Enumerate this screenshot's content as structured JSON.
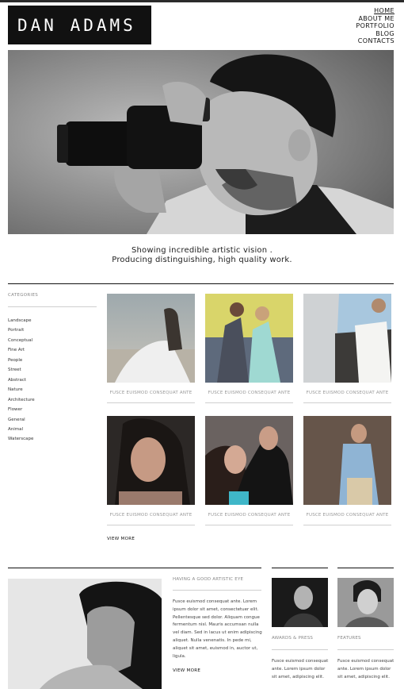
{
  "site": {
    "logo": "DAN ADAMS"
  },
  "nav": [
    {
      "label": "HOME",
      "active": true
    },
    {
      "label": "ABOUT ME"
    },
    {
      "label": "PORTFOLIO"
    },
    {
      "label": "BLOG"
    },
    {
      "label": "CONTACTS"
    }
  ],
  "hero": {
    "image": "photographer-with-camera-photo"
  },
  "tagline": {
    "line1": "Showing incredible artistic vision .",
    "line2": "Producing distinguishing, high quality work."
  },
  "sidebar": {
    "title": "CATEGORIES",
    "items": [
      "Landscape",
      "Portrait",
      "Conceptual",
      "Fine Art",
      "People",
      "Street",
      "Abstract",
      "Nature",
      "Architecture",
      "Flower",
      "General",
      "Animal",
      "Waterscape"
    ]
  },
  "gallery": {
    "items": [
      {
        "caption": "FUSCE EUISMOD CONSEQUAT ANTE",
        "image": "woman-in-white-dress-photo"
      },
      {
        "caption": "FUSCE EUISMOD CONSEQUAT ANTE",
        "image": "couple-by-motorbike-photo"
      },
      {
        "caption": "FUSCE EUISMOD CONSEQUAT ANTE",
        "image": "man-in-car-photo"
      },
      {
        "caption": "FUSCE EUISMOD CONSEQUAT ANTE",
        "image": "woman-portrait-photo"
      },
      {
        "caption": "FUSCE EUISMOD CONSEQUAT ANTE",
        "image": "couple-embrace-photo"
      },
      {
        "caption": "FUSCE EUISMOD CONSEQUAT ANTE",
        "image": "man-denim-jacket-photo"
      }
    ],
    "view_more": "VIEW MORE"
  },
  "about": {
    "title": "HAVING A GOOD ARTISTIC EYE",
    "text": "Fusce euismod consequat ante. Lorem ipsum dolor sit amet, consectetuer elit. Pellentesque sed dolor. Aliquam congue fermentum nisl. Mauris accumsan nulla vel diam. Sed in lacus ut enim adipiscing aliquet. Nulla venenatis. In pede mi, aliquet sit amet, euismod in, auctor ut, ligula.",
    "view_more": "VIEW MORE",
    "image": "man-black-white-portrait-photo"
  },
  "awards": {
    "title": "AWARDS & PRESS",
    "text": "Fusce euismod consequat ante. Lorem ipsum dolor sit amet, adipiscing elit.",
    "image": "woman-thinking-photo"
  },
  "features": {
    "title": "FEATURES",
    "text": "Fusce euismod consequat ante. Lorem ipsum dolor sit amet, adipiscing elit.",
    "image": "man-with-glasses-photo"
  }
}
